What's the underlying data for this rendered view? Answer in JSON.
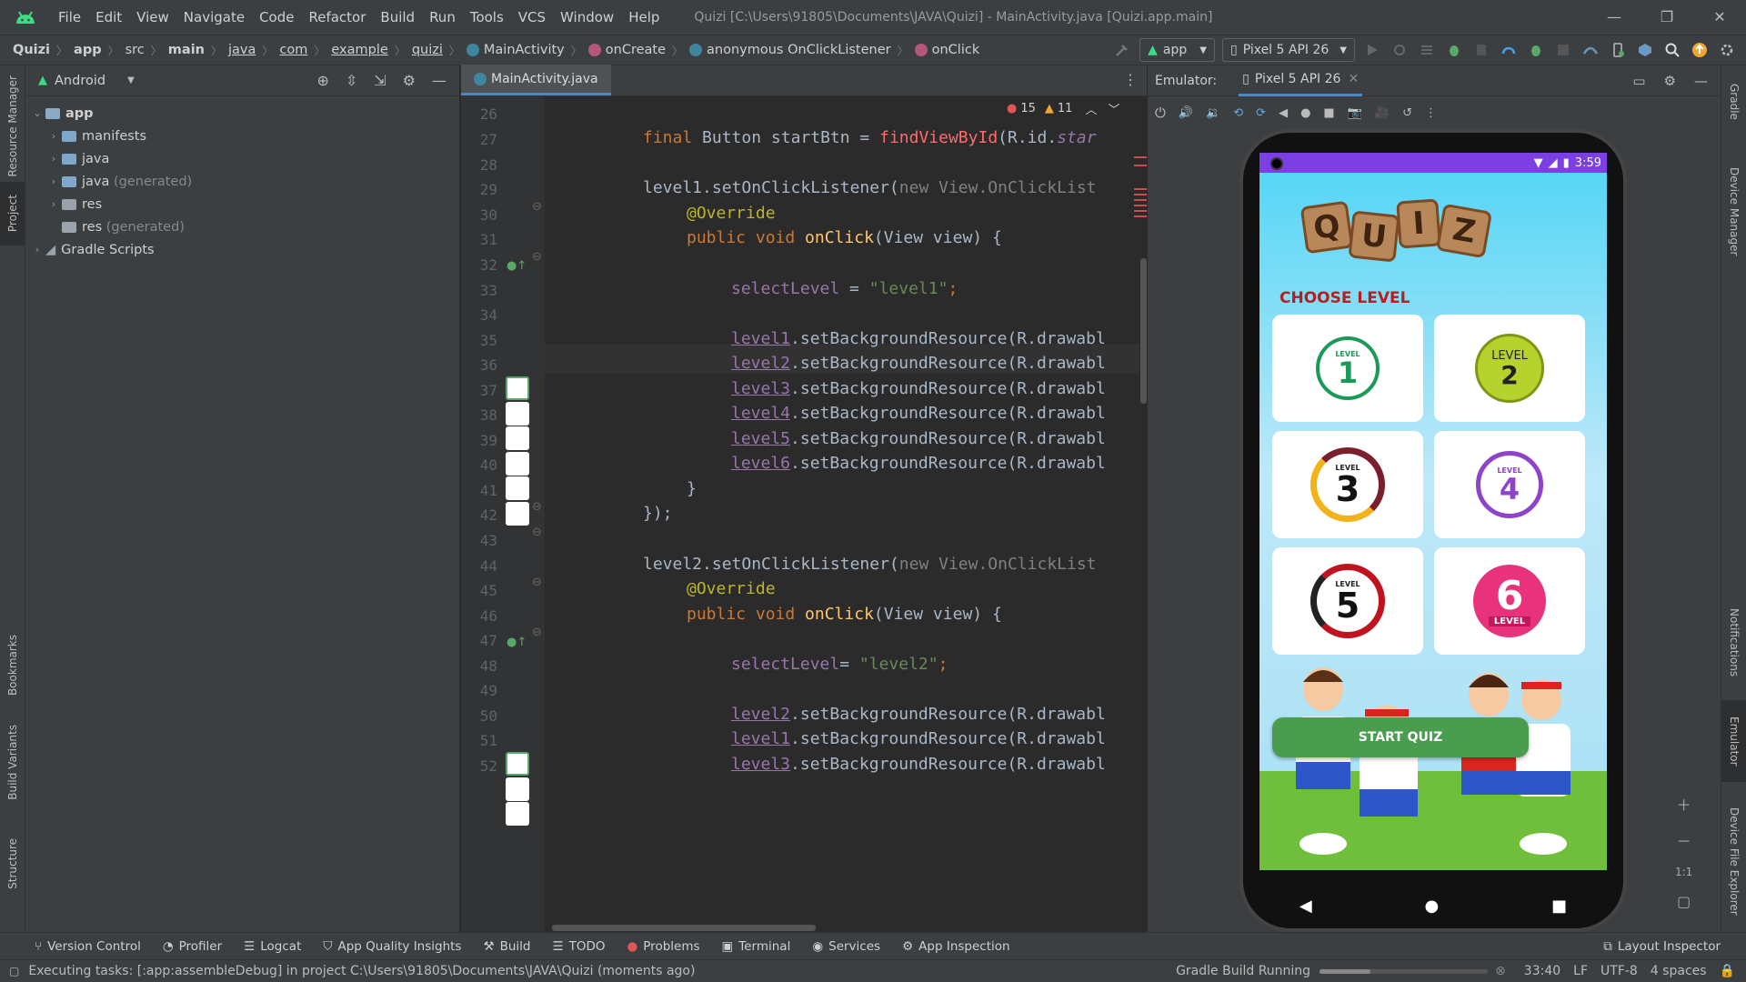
{
  "app": {
    "window_title": "Quizi [C:\\Users\\91805\\Documents\\JAVA\\Quizi] - MainActivity.java [Quizi.app.main]"
  },
  "menu": [
    "File",
    "Edit",
    "View",
    "Navigate",
    "Code",
    "Refactor",
    "Build",
    "Run",
    "Tools",
    "VCS",
    "Window",
    "Help"
  ],
  "breadcrumbs": [
    "Quizi",
    "app",
    "src",
    "main",
    "java",
    "com",
    "example",
    "quizi",
    "MainActivity",
    "onCreate",
    "anonymous OnClickListener",
    "onClick"
  ],
  "toolbar": {
    "run_config": "app",
    "device": "Pixel 5 API 26"
  },
  "left_tabs": [
    "Resource Manager",
    "Project",
    "Bookmarks",
    "Build Variants",
    "Structure"
  ],
  "project": {
    "view_mode": "Android",
    "tree": [
      {
        "label": "app",
        "depth": 0,
        "expanded": true
      },
      {
        "label": "manifests",
        "depth": 1
      },
      {
        "label": "java",
        "depth": 1
      },
      {
        "label": "java",
        "suffix": "(generated)",
        "depth": 1
      },
      {
        "label": "res",
        "depth": 1
      },
      {
        "label": "res",
        "suffix": "(generated)",
        "depth": 1
      },
      {
        "label": "Gradle Scripts",
        "depth": 0
      }
    ]
  },
  "editor": {
    "file_tab": "MainActivity.java",
    "errors": "15",
    "warnings": "11",
    "line_numbers": [
      "26",
      "27",
      "28",
      "29",
      "30",
      "31",
      "32",
      "33",
      "34",
      "35",
      "36",
      "37",
      "38",
      "39",
      "40",
      "41",
      "42",
      "43",
      "44",
      "45",
      "46",
      "47",
      "48",
      "49",
      "50",
      "51",
      "52"
    ],
    "code": {
      "l27a": "final ",
      "l27b": "Button startBtn = ",
      "l27c": "findViewById",
      "l27d": "(R.id.",
      "l27e": "star",
      "l29a": "level1.setOnClickListener(",
      "l29b": "new View.OnClickList",
      "l30": "@Override",
      "l31a": "public void ",
      "l31b": "onClick",
      "l31c": "(View view) {",
      "l33a": "selectLevel",
      "l33b": " = ",
      "l33c": "\"level1\"",
      "l33d": ";",
      "l35a": "level1",
      "l35b": ".setBackgroundResource(R.drawabl",
      "l36a": "level2",
      "l36b": ".setBackgroundResource(R.drawabl",
      "l37a": "level3",
      "l37b": ".setBackgroundResource(R.drawabl",
      "l38a": "level4",
      "l38b": ".setBackgroundResource(R.drawabl",
      "l39a": "level5",
      "l39b": ".setBackgroundResource(R.drawabl",
      "l40a": "level6",
      "l40b": ".setBackgroundResource(R.drawabl",
      "l41": "}",
      "l42": "});",
      "l44a": "level2.setOnClickListener(",
      "l44b": "new View.OnClickList",
      "l45": "@Override",
      "l46a": "public void ",
      "l46b": "onClick",
      "l46c": "(View view) {",
      "l48a": "selectLevel",
      "l48b": "= ",
      "l48c": "\"level2\"",
      "l48d": ";",
      "l50a": "level2",
      "l50b": ".setBackgroundResource(R.drawabl",
      "l51a": "level1",
      "l51b": ".setBackgroundResource(R.drawabl",
      "l52a": "level3",
      "l52b": ".setBackgroundResource(R.drawabl"
    }
  },
  "emulator": {
    "label": "Emulator:",
    "tab": "Pixel 5 API 26",
    "zoom_label": "1:1"
  },
  "phone": {
    "time": "3:59",
    "title_letters": [
      "Q",
      "U",
      "I",
      "Z"
    ],
    "choose_level": "CHOOSE LEVEL",
    "levels": [
      {
        "num": "1",
        "word": "LEVEL"
      },
      {
        "num": "2",
        "word": "LEVEL"
      },
      {
        "num": "3",
        "word": "LEVEL"
      },
      {
        "num": "4",
        "word": "LEVEL"
      },
      {
        "num": "5",
        "word": "LEVEL"
      },
      {
        "num": "6",
        "word": "LEVEL"
      }
    ],
    "start_button": "START QUIZ"
  },
  "right_tabs": [
    "Gradle",
    "Device Manager",
    "Notifications",
    "Emulator",
    "Device File Explorer"
  ],
  "bottom_tabs": [
    "Version Control",
    "Profiler",
    "Logcat",
    "App Quality Insights",
    "Build",
    "TODO",
    "Problems",
    "Terminal",
    "Services",
    "App Inspection"
  ],
  "bottom_right_tab": "Layout Inspector",
  "status": {
    "message": "Executing tasks: [:app:assembleDebug] in project C:\\Users\\91805\\Documents\\JAVA\\Quizi (moments ago)",
    "task": "Gradle Build Running",
    "position": "33:40",
    "line_sep": "LF",
    "encoding": "UTF-8",
    "indent": "4 spaces"
  },
  "colors": {
    "accent": "#4a88c7",
    "phone_statusbar": "#7b3fe4",
    "start_button": "#4a9d4e",
    "choose_level": "#b51f1f"
  }
}
